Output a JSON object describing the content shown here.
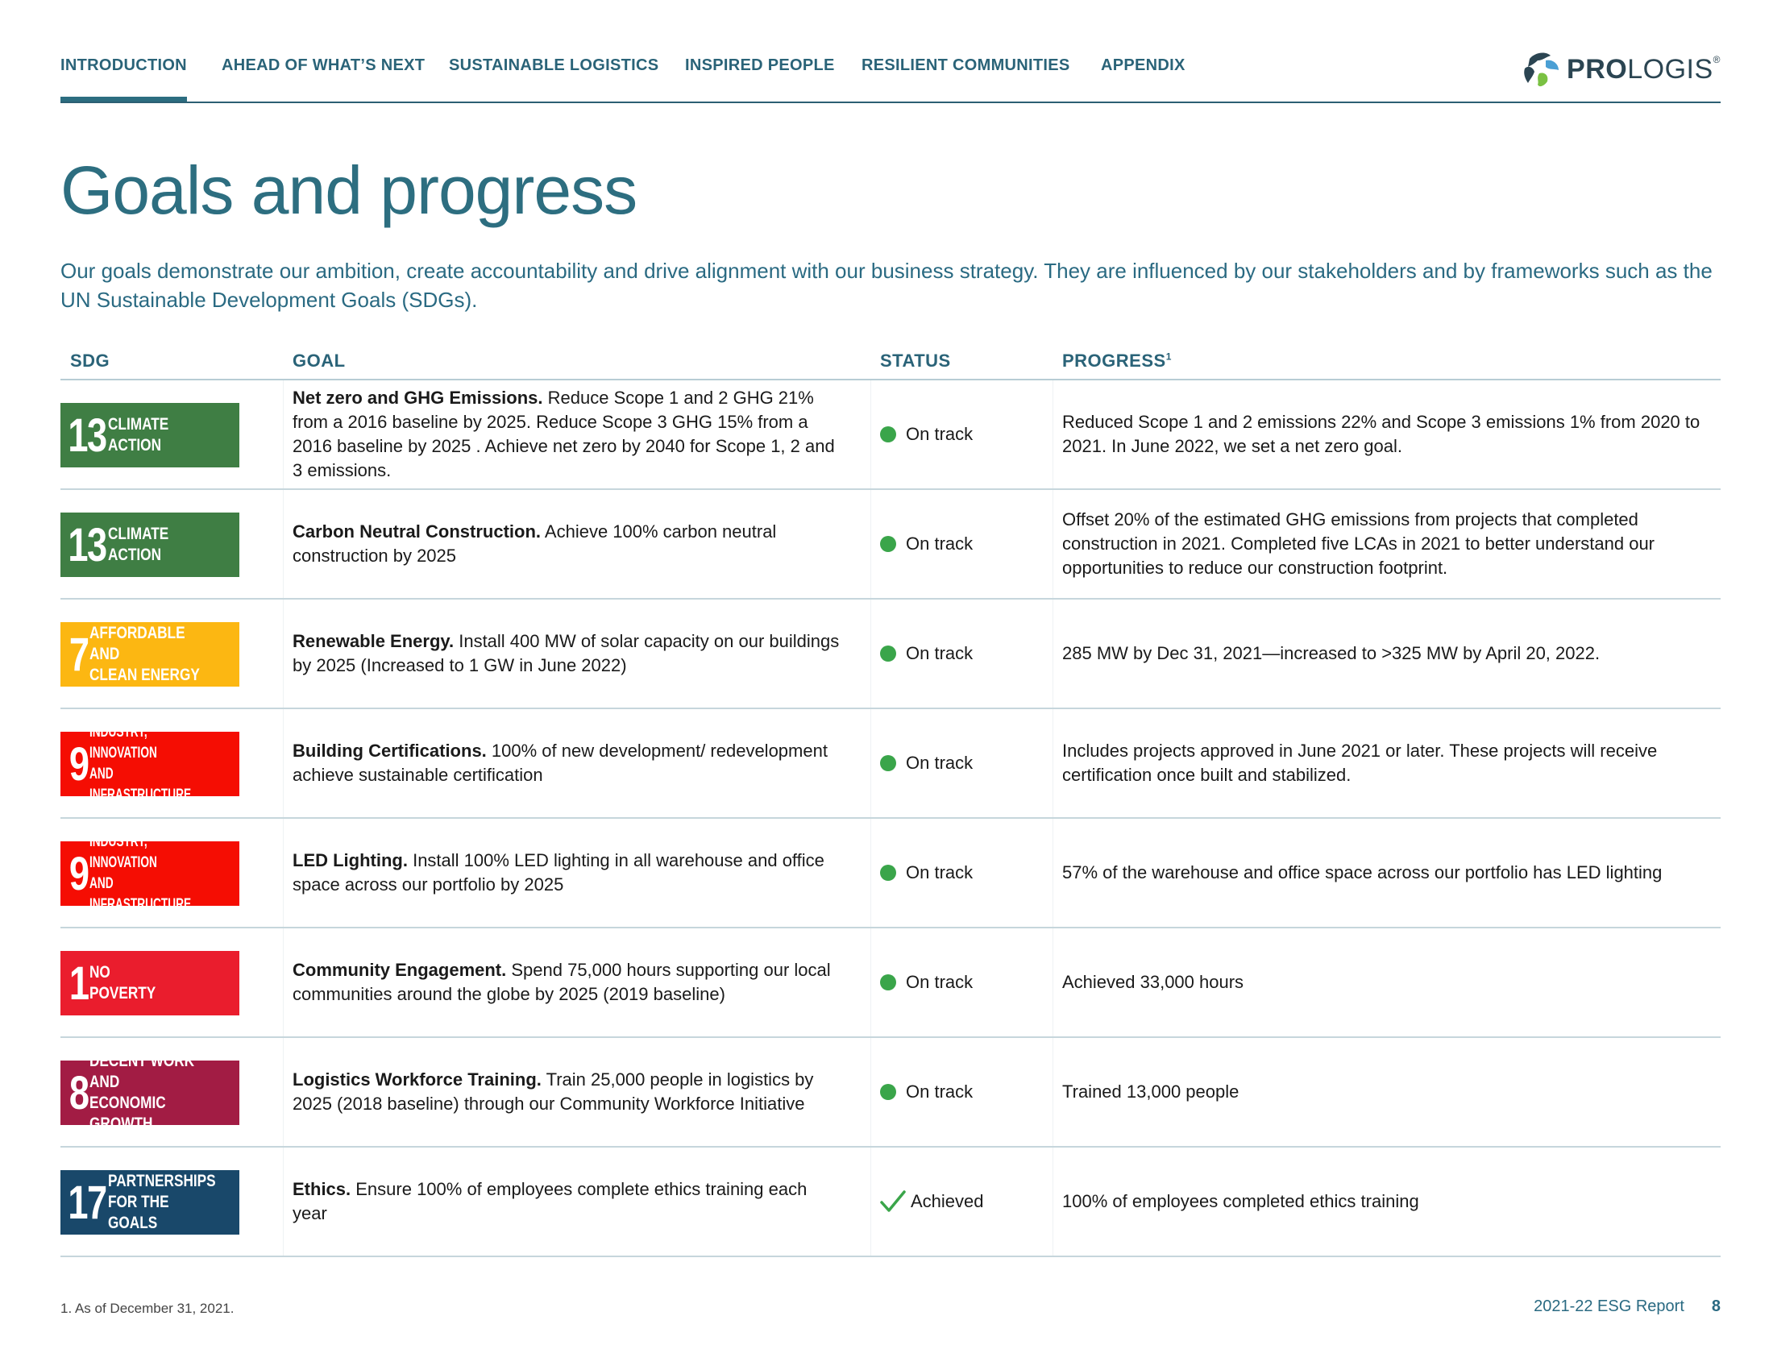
{
  "nav": {
    "items": [
      {
        "label": "INTRODUCTION",
        "active": true
      },
      {
        "label": "AHEAD OF WHAT’S NEXT",
        "active": false
      },
      {
        "label": "SUSTAINABLE LOGISTICS",
        "active": false
      },
      {
        "label": "INSPIRED PEOPLE",
        "active": false
      },
      {
        "label": "RESILIENT COMMUNITIES",
        "active": false
      },
      {
        "label": "APPENDIX",
        "active": false
      }
    ],
    "logo": {
      "bold": "PRO",
      "rest": "LOGIS",
      "reg": "®"
    }
  },
  "page_title": "Goals and progress",
  "intro": "Our goals demonstrate our ambition, create accountability and drive alignment with our business strategy. They are influenced by our stakeholders and by frameworks such as the UN Sustainable Development Goals (SDGs).",
  "table": {
    "headers": {
      "sdg": "SDG",
      "goal": "GOAL",
      "status": "STATUS",
      "progress": "PROGRESS",
      "progress_sup": "1"
    },
    "rows": [
      {
        "sdg_num": "13",
        "sdg_label": "CLIMATE\nACTION",
        "sdg_color": "#3f7e44",
        "goal_title": "Net zero and GHG Emissions.",
        "goal_text": " Reduce Scope 1 and 2 GHG 21% from a 2016 baseline by 2025. Reduce Scope 3 GHG 15% from a 2016 baseline by 2025 . Achieve net zero by 2040 for Scope 1, 2 and 3 emissions.",
        "status": "On track",
        "status_type": "dot",
        "progress": "Reduced Scope 1 and 2 emissions 22% and Scope 3 emissions 1% from 2020 to 2021. In June 2022, we set a net zero goal."
      },
      {
        "sdg_num": "13",
        "sdg_label": "CLIMATE\nACTION",
        "sdg_color": "#3f7e44",
        "goal_title": "Carbon Neutral Construction.",
        "goal_text": " Achieve 100% carbon neutral construction by 2025",
        "status": "On track",
        "status_type": "dot",
        "progress": "Offset 20% of the estimated GHG emissions from projects that completed construction in 2021. Completed five LCAs in 2021 to better understand our opportunities to reduce our construction footprint."
      },
      {
        "sdg_num": "7",
        "sdg_label": "AFFORDABLE AND\nCLEAN ENERGY",
        "sdg_color": "#fcb712",
        "goal_title": "Renewable Energy.",
        "goal_text": " Install 400 MW of solar capacity on our buildings by 2025 (Increased to 1 GW in June 2022)",
        "status": "On track",
        "status_type": "dot",
        "progress": "285 MW by Dec 31, 2021—increased to >325 MW by April 20, 2022."
      },
      {
        "sdg_num": "9",
        "sdg_label": "INDUSTRY, INNOVATION\nAND INFRASTRUCTURE",
        "sdg_color": "#f50d03",
        "goal_title": "Building Certifications.",
        "goal_text": " 100% of new development/ redevelopment achieve sustainable certification",
        "status": "On track",
        "status_type": "dot",
        "progress": "Includes projects approved in June 2021 or later. These projects will receive certification once built and stabilized."
      },
      {
        "sdg_num": "9",
        "sdg_label": "INDUSTRY, INNOVATION\nAND INFRASTRUCTURE",
        "sdg_color": "#f50d03",
        "goal_title": "LED Lighting.",
        "goal_text": " Install 100% LED lighting in all warehouse and office space across our portfolio by 2025",
        "status": "On track",
        "status_type": "dot",
        "progress": "57% of the warehouse and office space across our portfolio has LED lighting"
      },
      {
        "sdg_num": "1",
        "sdg_label": "NO\nPOVERTY",
        "sdg_color": "#ea1d2d",
        "goal_title": "Community Engagement.",
        "goal_text": " Spend 75,000 hours supporting our local communities around the globe by 2025 (2019 baseline)",
        "status": "On track",
        "status_type": "dot",
        "progress": "Achieved 33,000 hours"
      },
      {
        "sdg_num": "8",
        "sdg_label": "DECENT WORK AND\nECONOMIC GROWTH",
        "sdg_color": "#a21c44",
        "goal_title": "Logistics Workforce Training.",
        "goal_text": " Train 25,000 people in logistics by 2025 (2018 baseline) through our Community Workforce Initiative",
        "status": "On track",
        "status_type": "dot",
        "progress": "Trained 13,000 people"
      },
      {
        "sdg_num": "17",
        "sdg_label": "PARTNERSHIPS\nFOR THE GOALS",
        "sdg_color": "#19486a",
        "goal_title": "Ethics.",
        "goal_text": " Ensure 100% of employees complete ethics training each year",
        "status": "Achieved",
        "status_type": "check",
        "progress": "100% of employees completed ethics training"
      }
    ]
  },
  "footnote": "1.  As of December 31, 2021.",
  "footer": {
    "report": "2021-22 ESG Report",
    "page": "8"
  },
  "colors": {
    "accent": "#2a6378",
    "status_green": "#3aa54a"
  }
}
